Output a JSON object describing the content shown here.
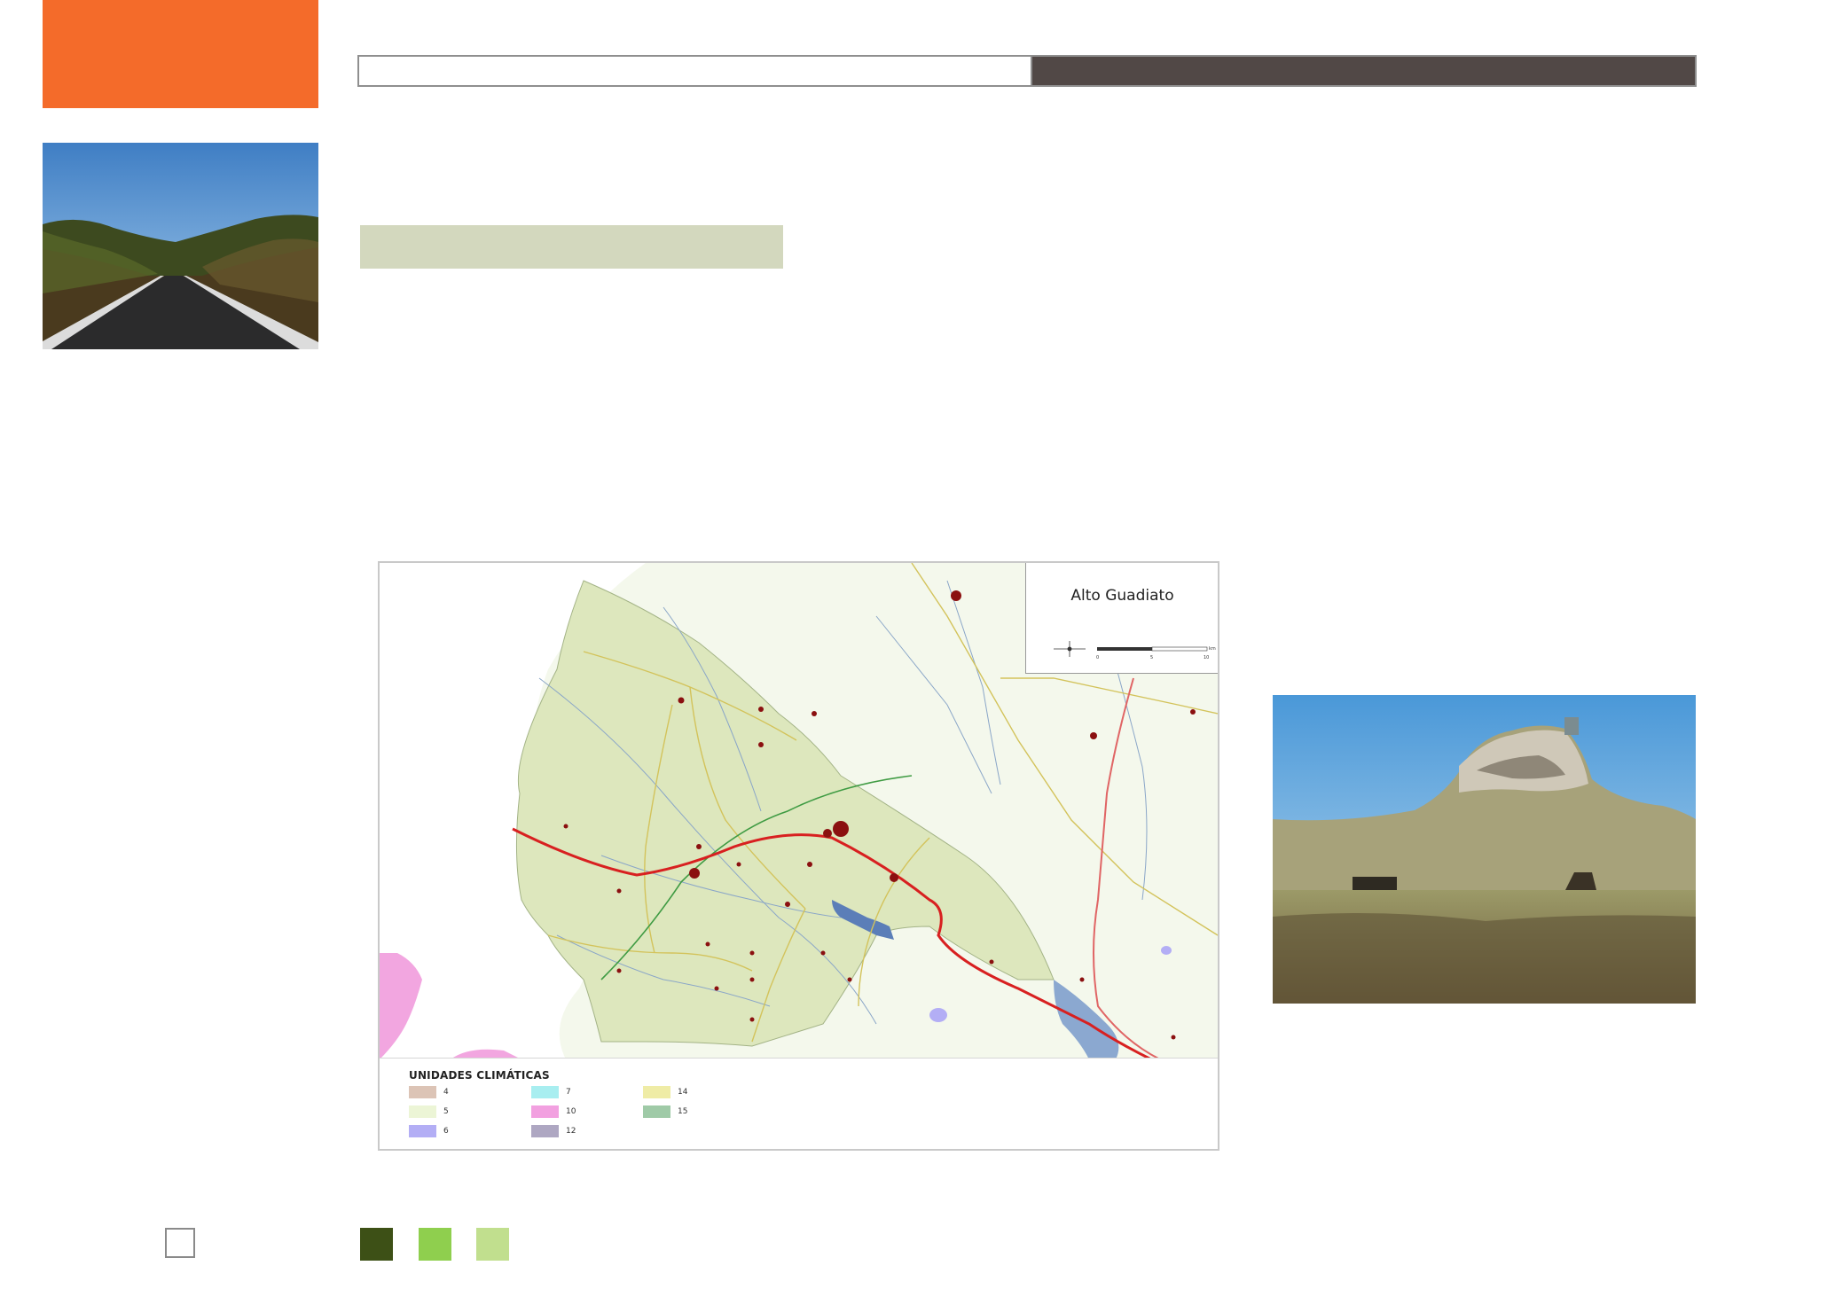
{
  "colors": {
    "accent_orange": "#f46b2a",
    "header_dark": "#514846",
    "section_label_bg": "#d3d8be",
    "square_dark_green": "#3d5016",
    "square_green": "#8fcf4e",
    "square_light_green": "#c1df8e"
  },
  "icons": {
    "road_photo": "road-landscape-photo-icon",
    "castle_photo": "castle-hill-photo-icon",
    "compass": "compass-rose-icon"
  },
  "map": {
    "title": "Alto Guadiato",
    "legend": {
      "title": "UNIDADES CLIMÁTICAS",
      "items": [
        {
          "label": "4",
          "color": "#dcc4b6"
        },
        {
          "label": "5",
          "color": "#ecf5d6"
        },
        {
          "label": "6",
          "color": "#b3aef5"
        },
        {
          "label": "7",
          "color": "#a8eef0"
        },
        {
          "label": "10",
          "color": "#f2a0e0"
        },
        {
          "label": "12",
          "color": "#aea7c2"
        },
        {
          "label": "14",
          "color": "#efeca6"
        },
        {
          "label": "15",
          "color": "#9fcaa7"
        }
      ]
    },
    "scale": {
      "ticks": [
        "0",
        "5",
        "10"
      ],
      "unit": "km"
    }
  }
}
